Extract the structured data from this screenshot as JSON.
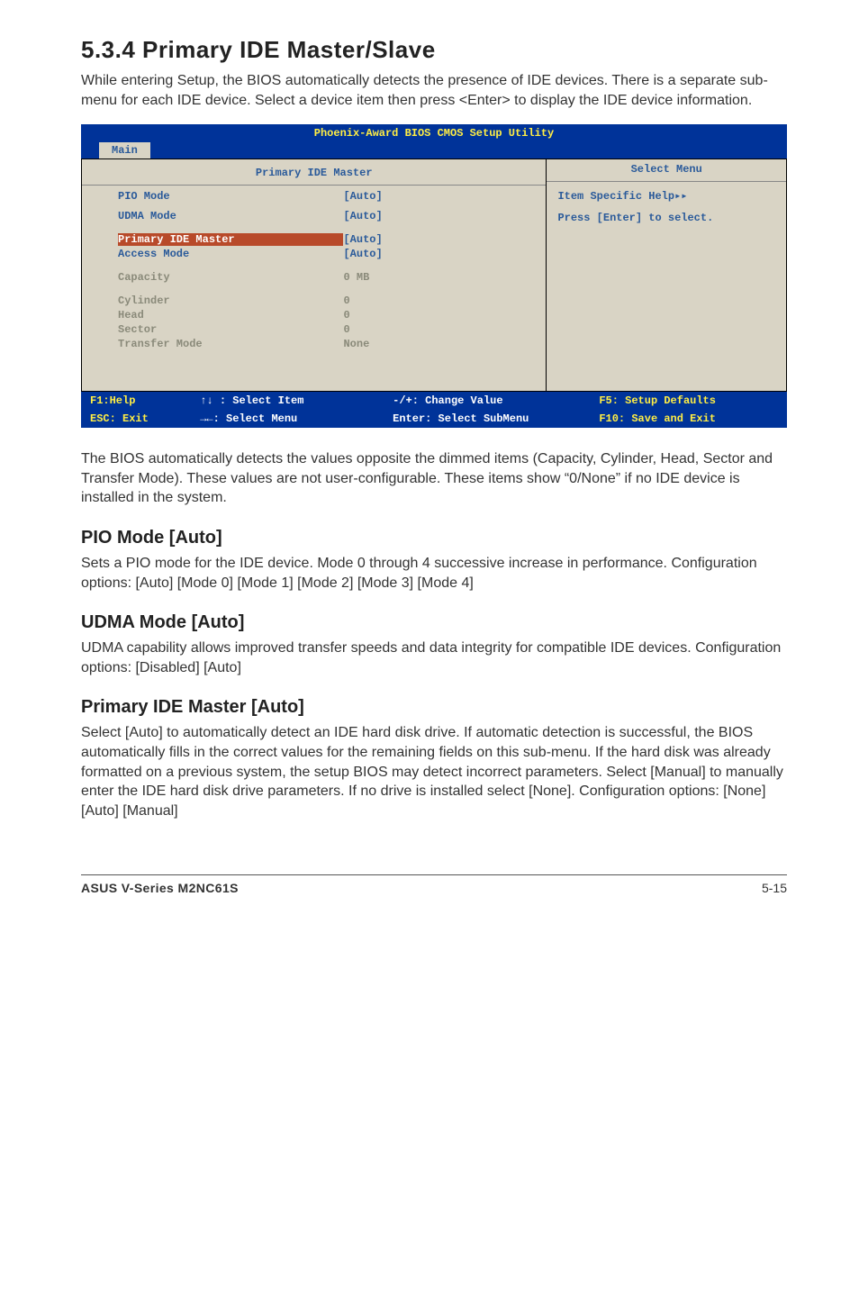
{
  "section": {
    "number_title": "5.3.4  Primary IDE Master/Slave",
    "intro": "While entering Setup, the BIOS automatically detects the presence of IDE devices. There is a separate sub-menu for each IDE device. Select a device item then press <Enter> to display the IDE device information."
  },
  "bios": {
    "title": "Phoenix-Award BIOS CMOS Setup Utility",
    "tab": "Main",
    "left_header": "Primary IDE Master",
    "right_header": "Select Menu",
    "help_line1": "Item Specific Help▸▸",
    "help_line2": "Press [Enter] to select.",
    "rows": [
      {
        "label": "PIO Mode",
        "value": "[Auto]",
        "dim": false,
        "hl": false
      },
      {
        "label": "UDMA Mode",
        "value": "[Auto]",
        "dim": false,
        "hl": false
      },
      {
        "label": "Primary IDE Master",
        "value": "[Auto]",
        "dim": false,
        "hl": true
      },
      {
        "label": "Access Mode",
        "value": "[Auto]",
        "dim": false,
        "hl": false
      },
      {
        "label": "Capacity",
        "value": "  0 MB",
        "dim": true,
        "hl": false
      },
      {
        "label": "Cylinder",
        "value": "   0",
        "dim": true,
        "hl": false
      },
      {
        "label": "Head",
        "value": "   0",
        "dim": true,
        "hl": false
      },
      {
        "label": "Sector",
        "value": "   0",
        "dim": true,
        "hl": false
      },
      {
        "label": "Transfer Mode",
        "value": " None",
        "dim": true,
        "hl": false
      }
    ],
    "footer": {
      "r1c1": "F1:Help",
      "r1c2": "↑↓ : Select Item",
      "r1c3": "-/+: Change Value",
      "r1c4": "F5: Setup Defaults",
      "r2c1": "ESC: Exit",
      "r2c2": "→←: Select Menu",
      "r2c3": "Enter: Select SubMenu",
      "r2c4": "F10: Save and Exit"
    }
  },
  "body_after_bios": "The BIOS automatically detects the values opposite the dimmed items (Capacity, Cylinder,  Head, Sector and Transfer Mode). These values are not user-configurable. These items show “0/None” if no IDE device is installed in the system.",
  "pio": {
    "heading": "PIO Mode [Auto]",
    "text": "Sets a PIO mode for the IDE device. Mode 0 through 4 successive increase in performance. Configuration options: [Auto] [Mode 0] [Mode 1] [Mode 2] [Mode 3] [Mode 4]"
  },
  "udma": {
    "heading": "UDMA Mode [Auto]",
    "text": "UDMA capability allows improved transfer speeds and data integrity for compatible IDE devices. Configuration options: [Disabled] [Auto]"
  },
  "primary": {
    "heading": "Primary IDE Master [Auto]",
    "text": "Select [Auto] to automatically detect an IDE hard disk drive. If automatic detection is successful, the BIOS automatically fills in the correct values for the remaining fields on this sub-menu. If the hard disk was already formatted on a previous system, the setup BIOS may detect incorrect parameters. Select [Manual] to manually enter the IDE hard disk drive parameters. If no drive is installed select [None]. Configuration options: [None] [Auto] [Manual]"
  },
  "footer": {
    "product": "ASUS V-Series M2NC61S",
    "page": "5-15"
  }
}
